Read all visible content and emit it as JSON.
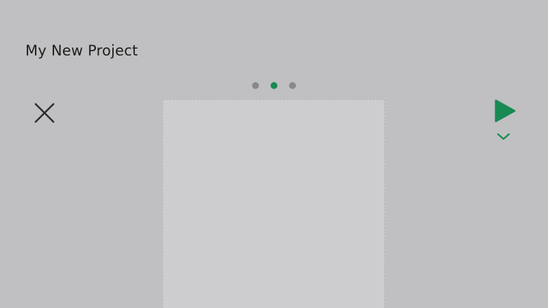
{
  "header": {
    "project_title": "My New Project"
  },
  "pager": {
    "page_count": 3,
    "active_index": 1
  },
  "icons": {
    "close": "close-icon",
    "play": "play-icon",
    "expand": "chevron-down-icon"
  },
  "colors": {
    "background": "#c0bfc1",
    "canvas": "#cdcccf",
    "accent": "#1a8a55",
    "dot_inactive": "#888789",
    "icon_dark": "#2b2b2b",
    "title_text": "#1e1e1e"
  }
}
